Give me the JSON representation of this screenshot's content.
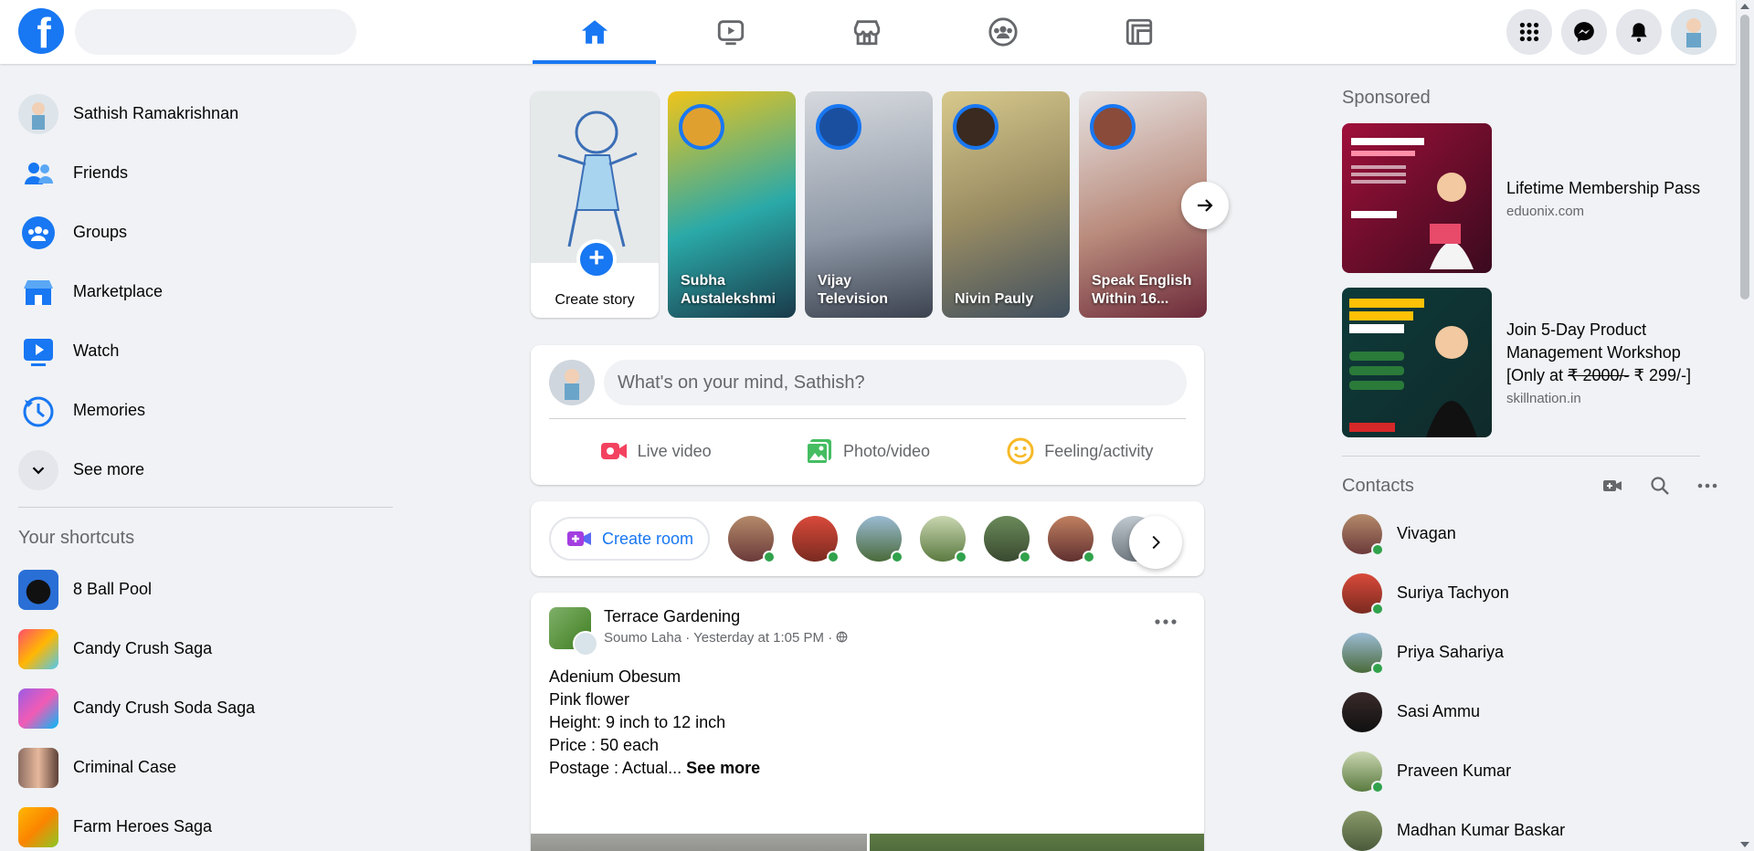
{
  "header": {
    "logo": "f",
    "search_placeholder": "",
    "nav_tabs": [
      {
        "name": "home",
        "icon": "home-icon",
        "active": true
      },
      {
        "name": "watch",
        "icon": "video-icon",
        "active": false
      },
      {
        "name": "marketplace",
        "icon": "store-icon",
        "active": false
      },
      {
        "name": "groups",
        "icon": "groups-icon",
        "active": false
      },
      {
        "name": "gaming",
        "icon": "gaming-icon",
        "active": false
      }
    ],
    "accent": "#1877f2"
  },
  "sidebar": {
    "items": [
      {
        "label": "Sathish Ramakrishnan",
        "icon": "avatar"
      },
      {
        "label": "Friends",
        "icon": "friends-icon"
      },
      {
        "label": "Groups",
        "icon": "groups-icon"
      },
      {
        "label": "Marketplace",
        "icon": "store-icon"
      },
      {
        "label": "Watch",
        "icon": "video-icon"
      },
      {
        "label": "Memories",
        "icon": "clock-icon"
      },
      {
        "label": "See more",
        "icon": "chevron-down-icon"
      }
    ],
    "shortcuts_title": "Your shortcuts",
    "shortcuts": [
      {
        "label": "8 Ball Pool"
      },
      {
        "label": "Candy Crush Saga"
      },
      {
        "label": "Candy Crush Soda Saga"
      },
      {
        "label": "Criminal Case"
      },
      {
        "label": "Farm Heroes Saga"
      }
    ]
  },
  "stories": {
    "create_label": "Create story",
    "items": [
      {
        "name": "Subha Austalekshmi"
      },
      {
        "name": "Vijay Television"
      },
      {
        "name": "Nivin Pauly"
      },
      {
        "name": "Speak English Within 16..."
      }
    ]
  },
  "composer": {
    "placeholder": "What's on your mind, Sathish?",
    "actions": [
      {
        "label": "Live video",
        "color": "#f3425f"
      },
      {
        "label": "Photo/video",
        "color": "#45bd62"
      },
      {
        "label": "Feeling/activity",
        "color": "#f7b928"
      }
    ]
  },
  "rooms": {
    "create_label": "Create room"
  },
  "post": {
    "group": "Terrace Gardening",
    "author": "Soumo Laha",
    "time": "Yesterday at 1:05 PM",
    "separator": "·",
    "lines": [
      "Adenium Obesum",
      "Pink flower",
      "Height: 9 inch to 12 inch",
      "Price : 50 each"
    ],
    "last_line": "Postage : Actual...",
    "see_more": "See more"
  },
  "right": {
    "sponsored_title": "Sponsored",
    "ads": [
      {
        "name": "Lifetime Membership Pass",
        "site": "eduonix.com"
      },
      {
        "name_prefix": "Join 5-Day Product Management Workshop [Only at ",
        "strike": "₹ 2000/-",
        "name_suffix": " ₹ 299/-]",
        "site": "skillnation.in"
      }
    ],
    "contacts_title": "Contacts",
    "contacts": [
      {
        "name": "Vivagan"
      },
      {
        "name": "Suriya Tachyon"
      },
      {
        "name": "Priya Sahariya"
      },
      {
        "name": "Sasi Ammu"
      },
      {
        "name": "Praveen Kumar"
      },
      {
        "name": "Madhan Kumar Baskar"
      }
    ]
  }
}
